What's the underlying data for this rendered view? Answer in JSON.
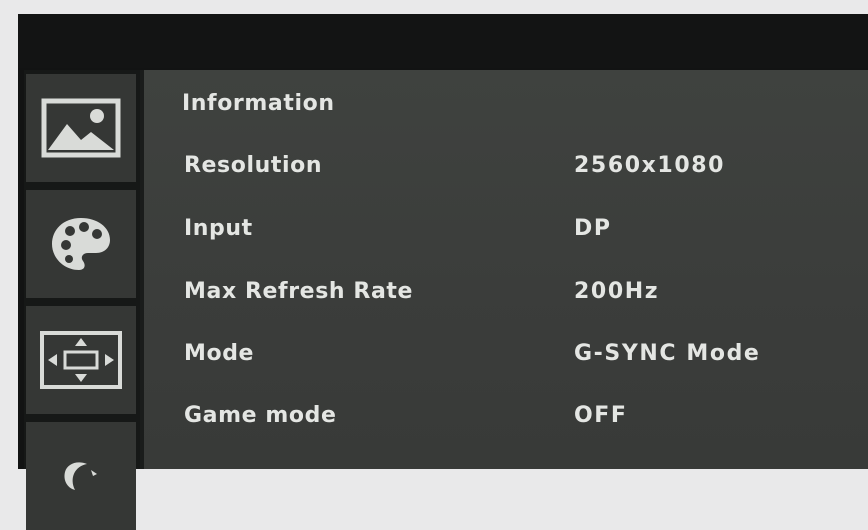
{
  "sidebar": {
    "items": [
      {
        "icon": "picture-icon"
      },
      {
        "icon": "palette-icon"
      },
      {
        "icon": "display-size-icon"
      },
      {
        "icon": "moon-icon"
      }
    ]
  },
  "panel": {
    "title": "Information",
    "rows": [
      {
        "label": "Resolution",
        "value": "2560x1080"
      },
      {
        "label": "Input",
        "value": "DP"
      },
      {
        "label": "Max Refresh Rate",
        "value": "200Hz"
      },
      {
        "label": "Mode",
        "value": "G-SYNC Mode"
      },
      {
        "label": "Game mode",
        "value": "OFF"
      }
    ]
  },
  "colors": {
    "panel_bg": "#3d403d",
    "sidebar_button": "#353735",
    "text": "#e4e6e3",
    "bezel": "#121313"
  }
}
